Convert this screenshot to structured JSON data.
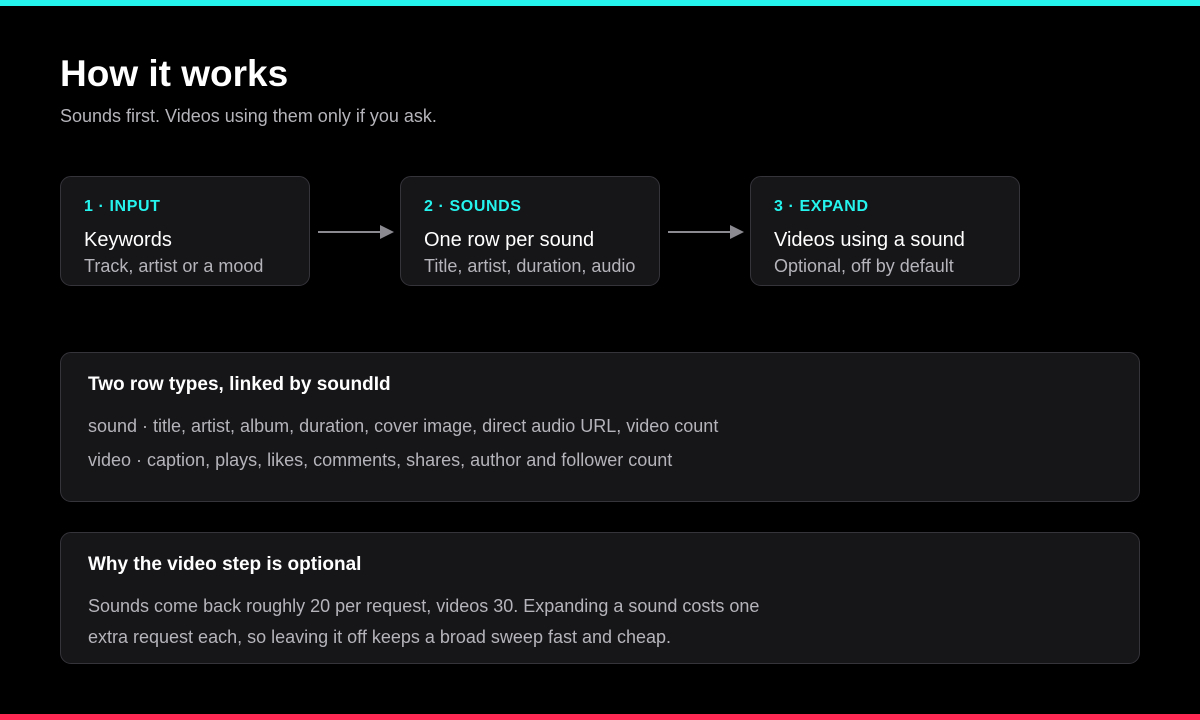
{
  "colors": {
    "accent_cyan": "#25f4ee",
    "accent_red": "#fe2c55",
    "background": "#000000",
    "card": "#161619",
    "border": "#34343a",
    "muted_text": "#b4b4ba",
    "arrow": "#8a8a90"
  },
  "header": {
    "title": "How it works",
    "subtitle": "Sounds first. Videos using them only if you ask."
  },
  "steps": [
    {
      "label": "1 · INPUT",
      "title": "Keywords",
      "description": "Track, artist or a mood"
    },
    {
      "label": "2 · SOUNDS",
      "title": "One row per sound",
      "description": "Title, artist, duration, audio"
    },
    {
      "label": "3 · EXPAND",
      "title": "Videos using a sound",
      "description": "Optional, off by default"
    }
  ],
  "panels": [
    {
      "title": "Two row types, linked by soundId",
      "lines": [
        "sound · title, artist, album, duration, cover image, direct audio URL, video count",
        "video · caption, plays, likes, comments, shares, author and follower count"
      ]
    },
    {
      "title": "Why the video step is optional",
      "lines": [
        "Sounds come back roughly 20 per request, videos 30. Expanding a sound costs one",
        "extra request each, so leaving it off keeps a broad sweep fast and cheap."
      ]
    }
  ]
}
